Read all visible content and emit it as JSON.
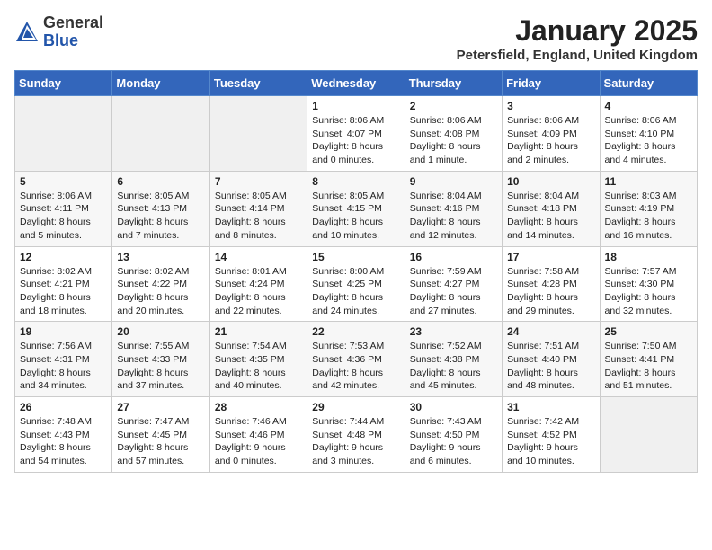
{
  "header": {
    "logo_general": "General",
    "logo_blue": "Blue",
    "month_title": "January 2025",
    "location": "Petersfield, England, United Kingdom"
  },
  "weekdays": [
    "Sunday",
    "Monday",
    "Tuesday",
    "Wednesday",
    "Thursday",
    "Friday",
    "Saturday"
  ],
  "weeks": [
    [
      {
        "day": "",
        "content": ""
      },
      {
        "day": "",
        "content": ""
      },
      {
        "day": "",
        "content": ""
      },
      {
        "day": "1",
        "content": "Sunrise: 8:06 AM\nSunset: 4:07 PM\nDaylight: 8 hours\nand 0 minutes."
      },
      {
        "day": "2",
        "content": "Sunrise: 8:06 AM\nSunset: 4:08 PM\nDaylight: 8 hours\nand 1 minute."
      },
      {
        "day": "3",
        "content": "Sunrise: 8:06 AM\nSunset: 4:09 PM\nDaylight: 8 hours\nand 2 minutes."
      },
      {
        "day": "4",
        "content": "Sunrise: 8:06 AM\nSunset: 4:10 PM\nDaylight: 8 hours\nand 4 minutes."
      }
    ],
    [
      {
        "day": "5",
        "content": "Sunrise: 8:06 AM\nSunset: 4:11 PM\nDaylight: 8 hours\nand 5 minutes."
      },
      {
        "day": "6",
        "content": "Sunrise: 8:05 AM\nSunset: 4:13 PM\nDaylight: 8 hours\nand 7 minutes."
      },
      {
        "day": "7",
        "content": "Sunrise: 8:05 AM\nSunset: 4:14 PM\nDaylight: 8 hours\nand 8 minutes."
      },
      {
        "day": "8",
        "content": "Sunrise: 8:05 AM\nSunset: 4:15 PM\nDaylight: 8 hours\nand 10 minutes."
      },
      {
        "day": "9",
        "content": "Sunrise: 8:04 AM\nSunset: 4:16 PM\nDaylight: 8 hours\nand 12 minutes."
      },
      {
        "day": "10",
        "content": "Sunrise: 8:04 AM\nSunset: 4:18 PM\nDaylight: 8 hours\nand 14 minutes."
      },
      {
        "day": "11",
        "content": "Sunrise: 8:03 AM\nSunset: 4:19 PM\nDaylight: 8 hours\nand 16 minutes."
      }
    ],
    [
      {
        "day": "12",
        "content": "Sunrise: 8:02 AM\nSunset: 4:21 PM\nDaylight: 8 hours\nand 18 minutes."
      },
      {
        "day": "13",
        "content": "Sunrise: 8:02 AM\nSunset: 4:22 PM\nDaylight: 8 hours\nand 20 minutes."
      },
      {
        "day": "14",
        "content": "Sunrise: 8:01 AM\nSunset: 4:24 PM\nDaylight: 8 hours\nand 22 minutes."
      },
      {
        "day": "15",
        "content": "Sunrise: 8:00 AM\nSunset: 4:25 PM\nDaylight: 8 hours\nand 24 minutes."
      },
      {
        "day": "16",
        "content": "Sunrise: 7:59 AM\nSunset: 4:27 PM\nDaylight: 8 hours\nand 27 minutes."
      },
      {
        "day": "17",
        "content": "Sunrise: 7:58 AM\nSunset: 4:28 PM\nDaylight: 8 hours\nand 29 minutes."
      },
      {
        "day": "18",
        "content": "Sunrise: 7:57 AM\nSunset: 4:30 PM\nDaylight: 8 hours\nand 32 minutes."
      }
    ],
    [
      {
        "day": "19",
        "content": "Sunrise: 7:56 AM\nSunset: 4:31 PM\nDaylight: 8 hours\nand 34 minutes."
      },
      {
        "day": "20",
        "content": "Sunrise: 7:55 AM\nSunset: 4:33 PM\nDaylight: 8 hours\nand 37 minutes."
      },
      {
        "day": "21",
        "content": "Sunrise: 7:54 AM\nSunset: 4:35 PM\nDaylight: 8 hours\nand 40 minutes."
      },
      {
        "day": "22",
        "content": "Sunrise: 7:53 AM\nSunset: 4:36 PM\nDaylight: 8 hours\nand 42 minutes."
      },
      {
        "day": "23",
        "content": "Sunrise: 7:52 AM\nSunset: 4:38 PM\nDaylight: 8 hours\nand 45 minutes."
      },
      {
        "day": "24",
        "content": "Sunrise: 7:51 AM\nSunset: 4:40 PM\nDaylight: 8 hours\nand 48 minutes."
      },
      {
        "day": "25",
        "content": "Sunrise: 7:50 AM\nSunset: 4:41 PM\nDaylight: 8 hours\nand 51 minutes."
      }
    ],
    [
      {
        "day": "26",
        "content": "Sunrise: 7:48 AM\nSunset: 4:43 PM\nDaylight: 8 hours\nand 54 minutes."
      },
      {
        "day": "27",
        "content": "Sunrise: 7:47 AM\nSunset: 4:45 PM\nDaylight: 8 hours\nand 57 minutes."
      },
      {
        "day": "28",
        "content": "Sunrise: 7:46 AM\nSunset: 4:46 PM\nDaylight: 9 hours\nand 0 minutes."
      },
      {
        "day": "29",
        "content": "Sunrise: 7:44 AM\nSunset: 4:48 PM\nDaylight: 9 hours\nand 3 minutes."
      },
      {
        "day": "30",
        "content": "Sunrise: 7:43 AM\nSunset: 4:50 PM\nDaylight: 9 hours\nand 6 minutes."
      },
      {
        "day": "31",
        "content": "Sunrise: 7:42 AM\nSunset: 4:52 PM\nDaylight: 9 hours\nand 10 minutes."
      },
      {
        "day": "",
        "content": ""
      }
    ]
  ]
}
